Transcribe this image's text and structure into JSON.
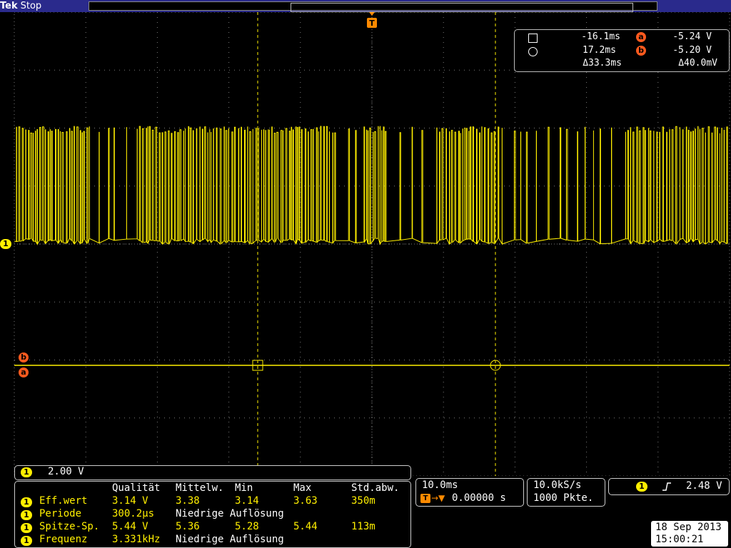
{
  "brand": {
    "name": "Tek",
    "state": "Stop"
  },
  "colors": {
    "trace": "#ffef00",
    "cursor_badge": "#ff5a1e",
    "topbar": "#2a2a8c",
    "grid": "#7a7a7a"
  },
  "trigger_marker": {
    "label": "T"
  },
  "cursor_readout": {
    "square_time": "-16.1ms",
    "circle_time": "17.2ms",
    "delta_time": "Δ33.3ms",
    "a_label": "a",
    "a_value": "-5.24 V",
    "b_label": "b",
    "b_value": "-5.20 V",
    "delta_value": "Δ40.0mV"
  },
  "channel_marker": {
    "label": "1"
  },
  "ref_markers": {
    "b": "b",
    "a": "a"
  },
  "channel_scale": {
    "channel": "1",
    "value": "2.00 V"
  },
  "measurements": {
    "headers": [
      "Qualität",
      "Mittelw.",
      "Min",
      "Max",
      "Std.abw."
    ],
    "rows": [
      {
        "ch": "1",
        "name": "Eff.wert",
        "value": "3.14 V",
        "mean": "3.38",
        "min": "3.14",
        "max": "3.63",
        "std": "350m"
      },
      {
        "ch": "1",
        "name": "Periode",
        "value": "300.2µs",
        "mean": "Niedrige Auflösung",
        "min": "",
        "max": "",
        "std": ""
      },
      {
        "ch": "1",
        "name": "Spitze-Sp.",
        "value": "5.44 V",
        "mean": "5.36",
        "min": "5.28",
        "max": "5.44",
        "std": "113m"
      },
      {
        "ch": "1",
        "name": "Frequenz",
        "value": "3.331kHz",
        "mean": "Niedrige Auflösung",
        "min": "",
        "max": "",
        "std": ""
      }
    ]
  },
  "horizontal": {
    "scale": "10.0ms",
    "position": "0.00000 s"
  },
  "acquisition": {
    "rate": "10.0kS/s",
    "length": "1000 Pkte."
  },
  "trigger": {
    "channel": "1",
    "slope": "rising-edge-icon",
    "level": "2.48 V"
  },
  "datetime": {
    "date": "18 Sep 2013",
    "time": "15:00:21"
  }
}
